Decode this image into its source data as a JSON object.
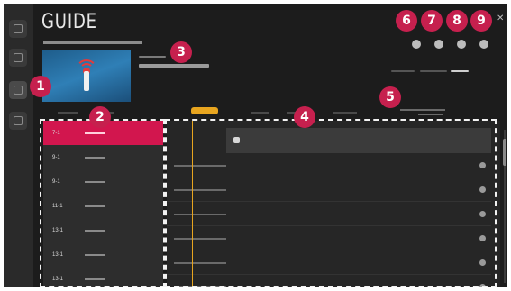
{
  "header": {
    "title": "GUIDE"
  },
  "callouts": [
    "1",
    "2",
    "3",
    "4",
    "5",
    "6",
    "7",
    "8",
    "9"
  ],
  "channels": [
    {
      "number": "7-1"
    },
    {
      "number": "9-1"
    },
    {
      "number": "9-1"
    },
    {
      "number": "11-1"
    },
    {
      "number": "13-1"
    },
    {
      "number": "13-1"
    },
    {
      "number": "13-1"
    }
  ],
  "colors": {
    "accent": "#d2164e",
    "badge": "#c6204e",
    "now_indicator": "#e8a51f",
    "background": "#1c1c1c"
  },
  "icons": {
    "rail": [
      "search-icon",
      "home-icon",
      "tv-icon",
      "search-icon"
    ],
    "top_buttons": [
      "record-icon",
      "reminder-icon",
      "filter-icon",
      "settings-icon"
    ],
    "close": "close-icon"
  }
}
